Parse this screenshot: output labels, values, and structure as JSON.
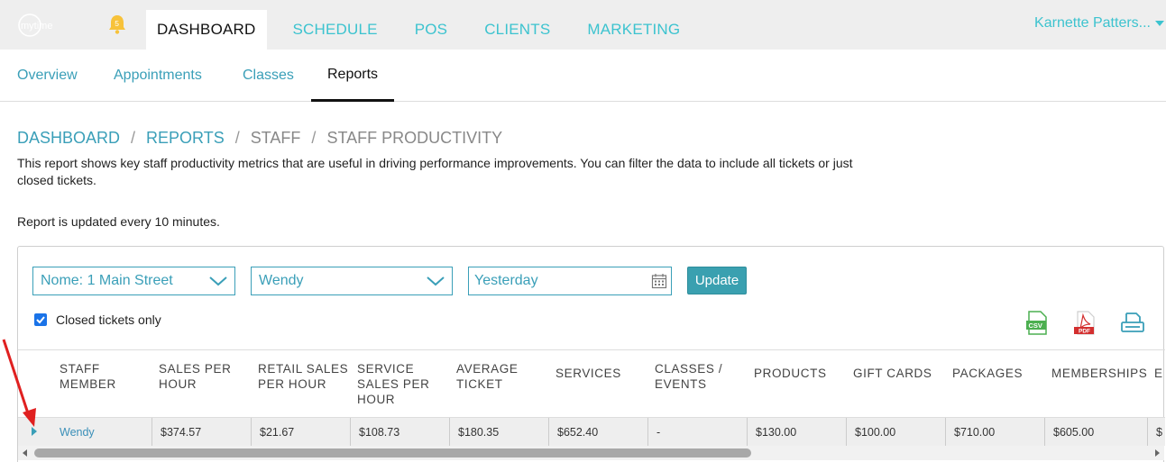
{
  "topbar": {
    "logo_text": "mytime",
    "notification_count": "5",
    "nav": [
      "DASHBOARD",
      "SCHEDULE",
      "POS",
      "CLIENTS",
      "MARKETING"
    ],
    "user_name": "Karnette Patters..."
  },
  "subnav": {
    "tabs": [
      "Overview",
      "Appointments",
      "Classes",
      "Reports"
    ]
  },
  "breadcrumb": {
    "items": [
      "DASHBOARD",
      "REPORTS",
      "STAFF",
      "STAFF PRODUCTIVITY"
    ],
    "separator": "/"
  },
  "description": "This report shows key staff productivity metrics that are useful in driving performance improvements. You can filter the data to include all tickets or just closed tickets.",
  "updated_note": "Report is updated every 10 minutes.",
  "filters": {
    "location": "Nome: 1 Main Street",
    "staff": "Wendy",
    "date": "Yesterday",
    "update_label": "Update",
    "closed_label": "Closed tickets only",
    "closed_checked": true
  },
  "exports": [
    "csv-icon",
    "pdf-icon",
    "print-icon"
  ],
  "table": {
    "columns": [
      "STAFF MEMBER",
      "SALES PER HOUR",
      "RETAIL SALES PER HOUR",
      "SERVICE SALES PER HOUR",
      "AVERAGE TICKET",
      "SERVICES",
      "CLASSES / EVENTS",
      "PRODUCTS",
      "GIFT CARDS",
      "PACKAGES",
      "MEMBERSHIPS",
      "E"
    ],
    "rows": [
      [
        "Wendy",
        "$374.57",
        "$21.67",
        "$108.73",
        "$180.35",
        "$652.40",
        "-",
        "$130.00",
        "$100.00",
        "$710.00",
        "$605.00",
        "$"
      ]
    ]
  },
  "colors": {
    "accent": "#3cc3cf",
    "link": "#3a9fb8",
    "button": "#3aa0b0",
    "annotation_arrow": "#e02020"
  }
}
